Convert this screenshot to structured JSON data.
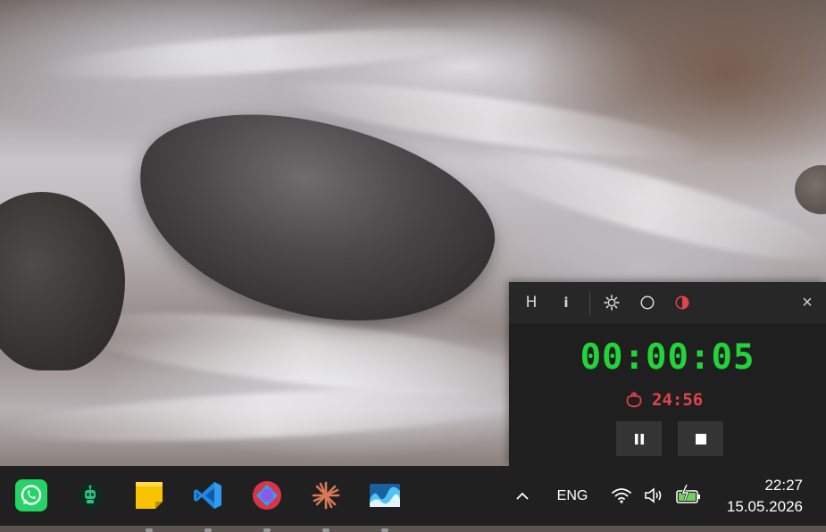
{
  "timer": {
    "toolbar": {
      "history_label": "H",
      "info_label": "i",
      "close_label": "×",
      "icons": [
        "settings-gear-icon",
        "circle-outline-icon",
        "contrast-half-icon"
      ],
      "accent_color": "#e0444c"
    },
    "elapsed": "00:00:05",
    "elapsed_color": "#22d43a",
    "countdown": "24:56",
    "countdown_color": "#e0444c",
    "controls": [
      "pause",
      "stop"
    ]
  },
  "taskbar": {
    "apps": [
      {
        "name": "WhatsApp",
        "icon": "whatsapp-icon",
        "color": "#25d366"
      },
      {
        "name": "Robot app",
        "icon": "robot-icon",
        "color": "#1a8a5a"
      },
      {
        "name": "Sticky Notes",
        "icon": "sticky-notes-icon",
        "color": "#f7c300"
      },
      {
        "name": "Visual Studio Code",
        "icon": "vscode-icon",
        "color": "#1e88e5"
      },
      {
        "name": "Browser",
        "icon": "browser-icon",
        "color": "#d9344a"
      },
      {
        "name": "Claude",
        "icon": "sunburst-icon",
        "color": "#d97757"
      },
      {
        "name": "Monitor",
        "icon": "wave-chart-icon",
        "color": "#2c9be0"
      }
    ],
    "tray": {
      "chevron": "^",
      "language": "ENG",
      "icons": [
        "wifi-icon",
        "volume-icon",
        "battery-charging-icon"
      ],
      "time": "22:27",
      "date": "15.05.2026"
    }
  }
}
